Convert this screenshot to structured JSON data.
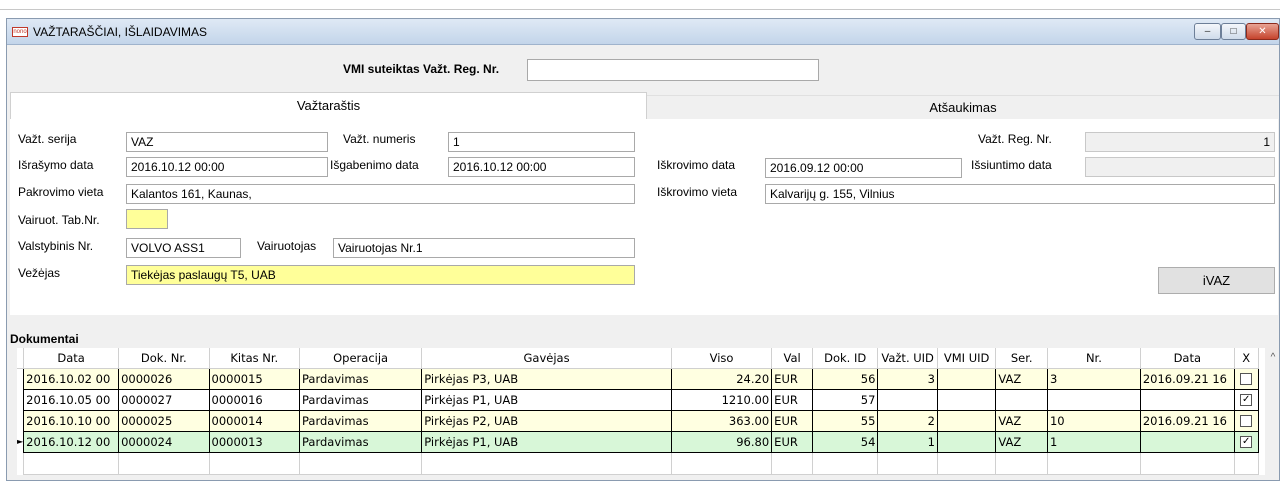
{
  "window": {
    "title": "VAŽTARAŠČIAI, IŠLAIDAVIMAS",
    "app_icon_text": "nono",
    "buttons": {
      "minimize": "–",
      "maximize": "□",
      "close": "✕"
    }
  },
  "vmi": {
    "label": "VMI suteiktas Važt. Reg. Nr.",
    "value": ""
  },
  "tabs": [
    {
      "label": "Važtaraštis",
      "active": true
    },
    {
      "label": "Atšaukimas",
      "active": false
    }
  ],
  "form": {
    "serija": {
      "label": "Važt. serija",
      "value": "VAZ"
    },
    "numeris": {
      "label": "Važt. numeris",
      "value": "1"
    },
    "reg_nr": {
      "label": "Važt. Reg. Nr.",
      "value": "1"
    },
    "israsymo": {
      "label": "Išrašymo data",
      "value": "2016.10.12 00:00"
    },
    "isgabenimo": {
      "label": "Išgabenimo data",
      "value": "2016.10.12 00:00"
    },
    "iskrovimo_data": {
      "label": "Iškrovimo data",
      "value": "2016.09.12 00:00"
    },
    "issiuntimo": {
      "label": "Išsiuntimo data",
      "value": ""
    },
    "pakrovimo": {
      "label": "Pakrovimo vieta",
      "value": "Kalantos 161, Kaunas,"
    },
    "iskrovimo_vieta": {
      "label": "Iškrovimo vieta",
      "value": "Kalvarijų g. 155, Vilnius"
    },
    "tab_nr": {
      "label": "Vairuot. Tab.Nr.",
      "value": ""
    },
    "valstybinis": {
      "label": "Valstybinis Nr.",
      "value": "VOLVO ASS1"
    },
    "vairuotojas": {
      "label": "Vairuotojas",
      "value": "Vairuotojas Nr.1"
    },
    "vezejas": {
      "label": "Vežėjas",
      "value": "Tiekėjas paslaugų T5, UAB"
    },
    "ivaz_button": "iVAZ"
  },
  "documents": {
    "title": "Dokumentai",
    "columns": [
      "Data",
      "Dok. Nr.",
      "Kitas Nr.",
      "Operacija",
      "Gavėjas",
      "Viso",
      "Val",
      "Dok. ID",
      "Važt. UID",
      "VMI UID",
      "Ser.",
      "Nr.",
      "Data",
      "X"
    ],
    "rows": [
      {
        "style": "y",
        "cells": [
          "2016.10.02 00",
          "0000026",
          "0000015",
          "Pardavimas",
          "Pirkėjas P3, UAB",
          "24.20",
          "EUR",
          "56",
          "3",
          "",
          "VAZ",
          "3",
          "2016.09.21 16"
        ],
        "checked": false,
        "current": false
      },
      {
        "style": "w",
        "cells": [
          "2016.10.05 00",
          "0000027",
          "0000016",
          "Pardavimas",
          "Pirkėjas P1, UAB",
          "1210.00",
          "EUR",
          "57",
          "",
          "",
          "",
          "",
          ""
        ],
        "checked": true,
        "current": false
      },
      {
        "style": "y",
        "cells": [
          "2016.10.10 00",
          "0000025",
          "0000014",
          "Pardavimas",
          "Pirkėjas P2, UAB",
          "363.00",
          "EUR",
          "55",
          "2",
          "",
          "VAZ",
          "10",
          "2016.09.21 16"
        ],
        "checked": false,
        "current": false
      },
      {
        "style": "g",
        "cells": [
          "2016.10.12 00",
          "0000024",
          "0000013",
          "Pardavimas",
          "Pirkėjas P1, UAB",
          "96.80",
          "EUR",
          "54",
          "1",
          "",
          "VAZ",
          "1",
          ""
        ],
        "checked": true,
        "current": true
      }
    ]
  },
  "icons": {
    "row_indicator": "row-pointer-icon",
    "scroll_up": "chevron-up-icon",
    "check": "checkmark-icon"
  }
}
